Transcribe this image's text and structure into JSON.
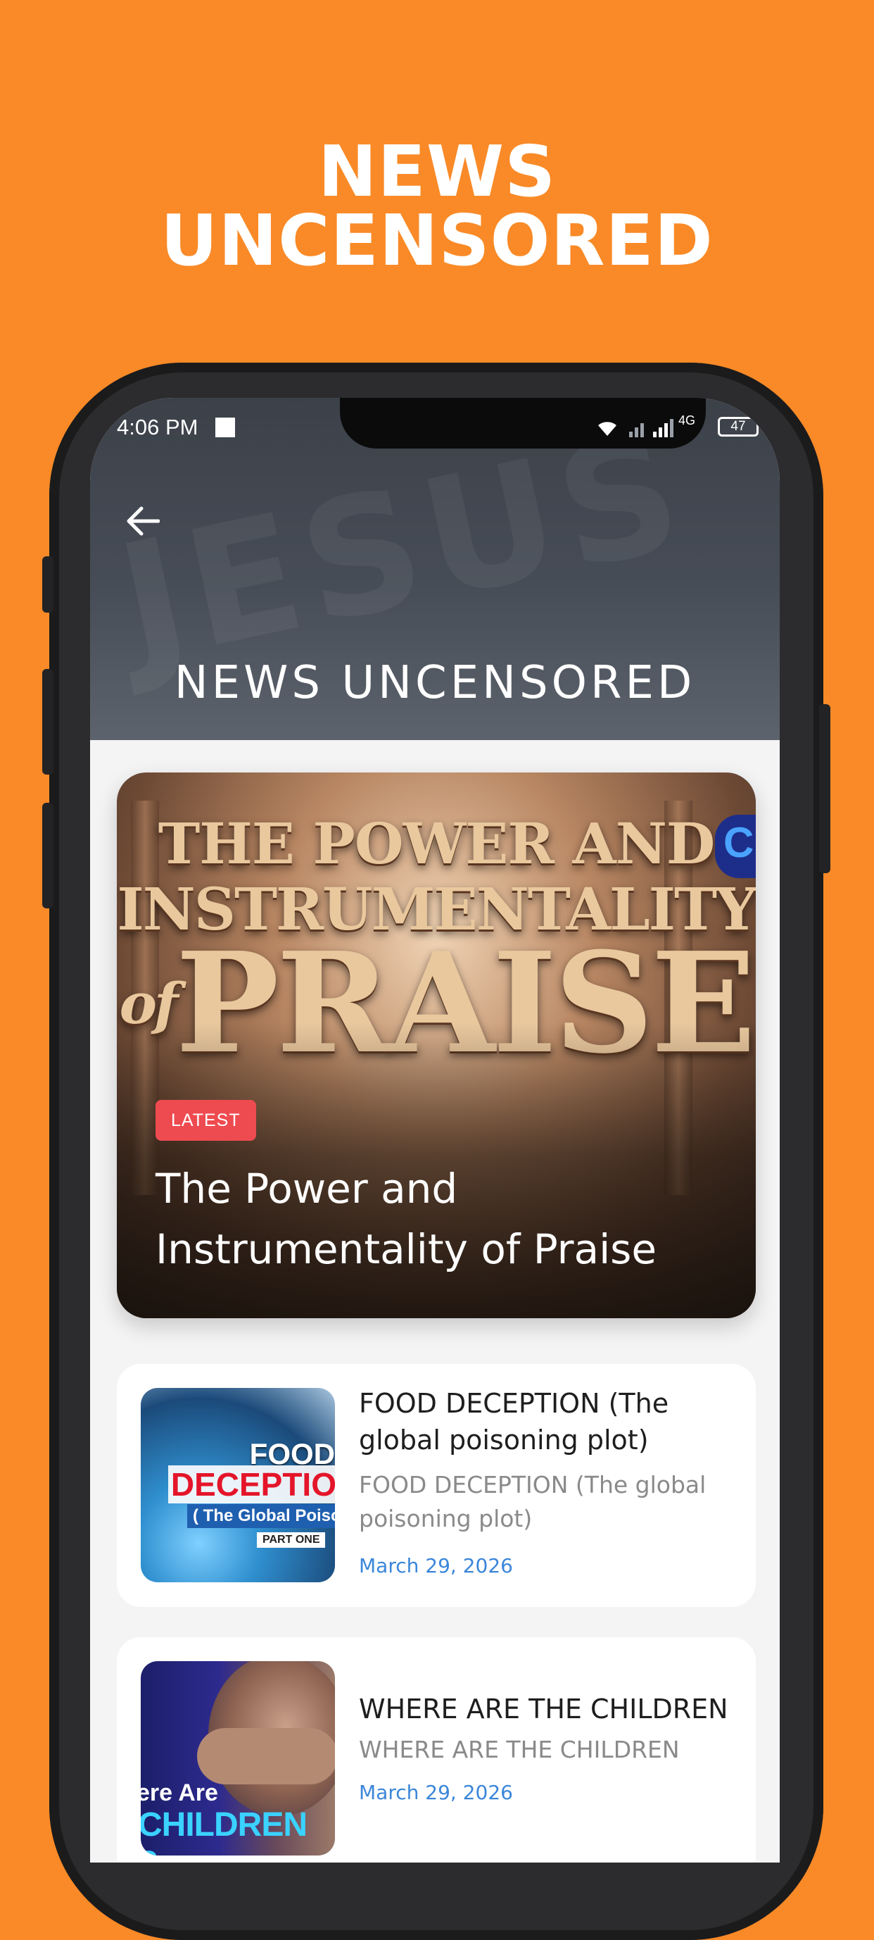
{
  "promo": {
    "line1": "NEWS",
    "line2": "UNCENSORED"
  },
  "status_bar": {
    "time": "4:06 PM",
    "network": "4G",
    "battery": "47"
  },
  "header": {
    "title": "NEWS UNCENSORED",
    "watermark": "JESUS"
  },
  "featured": {
    "badge": "LATEST",
    "title": "The Power and Instrumentality of Praise",
    "art_line1": "THE POWER AND",
    "art_line2": "INSTRUMENTALITY",
    "art_of": "of",
    "art_line3": "PRAISE",
    "art_logo": "C"
  },
  "articles": [
    {
      "title": "FOOD DECEPTION (The global poisoning plot)",
      "subtitle": "FOOD DECEPTION (The global poisoning plot)",
      "date": "March 29, 2026",
      "thumb_text": [
        "FOOD",
        "DECEPTIO",
        "( The Global Poison",
        "PART ONE"
      ]
    },
    {
      "title": "WHERE ARE THE CHILDREN",
      "subtitle": "WHERE ARE THE CHILDREN",
      "date": "March 29, 2026",
      "thumb_text": [
        "ere Are",
        "CHILDREN ?"
      ]
    }
  ],
  "colors": {
    "background": "#F98A27",
    "badge": "#EE4B50",
    "date": "#3B86D9"
  }
}
